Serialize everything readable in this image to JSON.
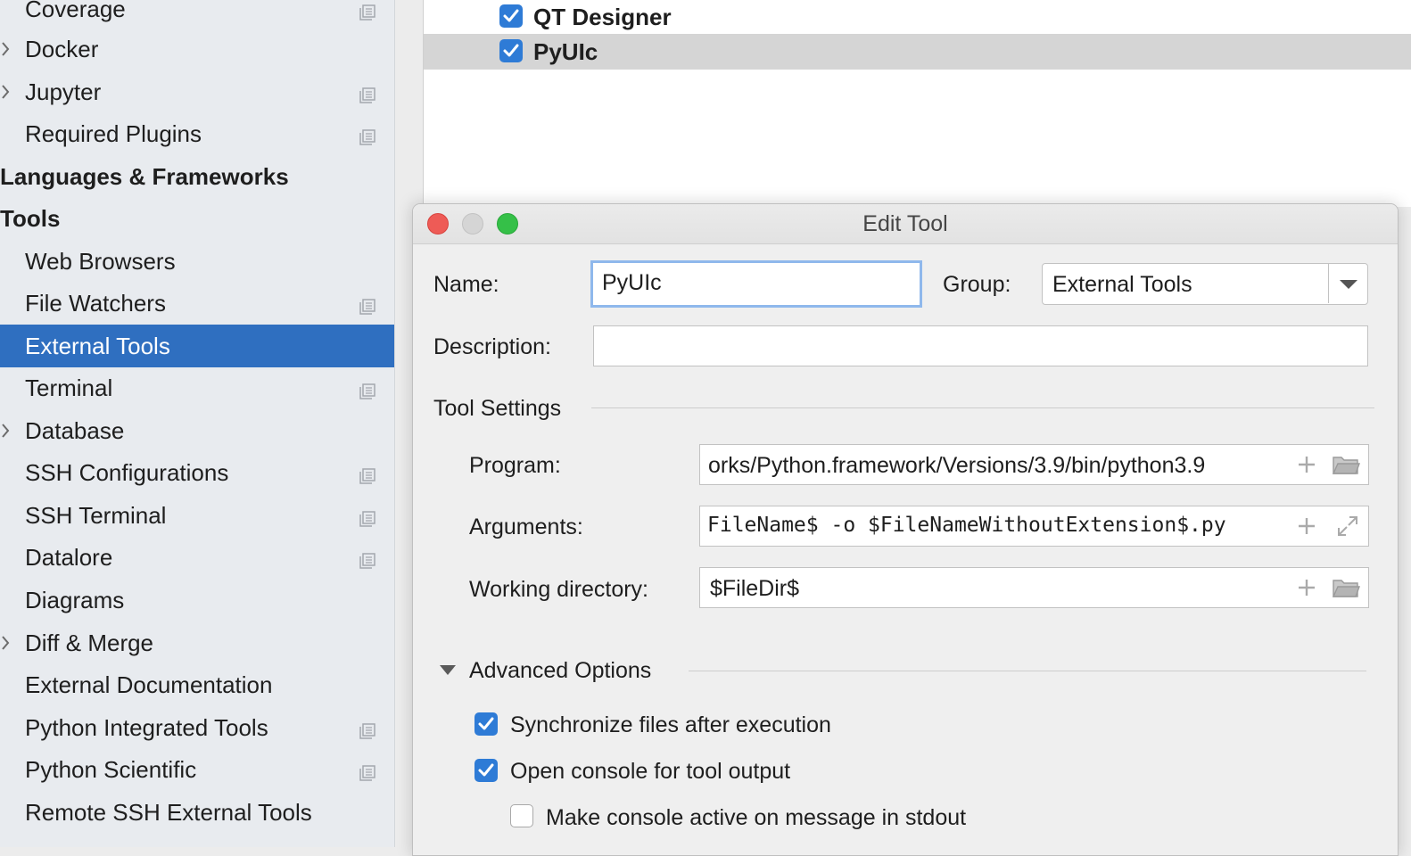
{
  "sidebar": {
    "items": [
      {
        "label": "Coverage",
        "type": "item",
        "arrow": false,
        "proj": true
      },
      {
        "label": "Docker",
        "type": "item",
        "arrow": true,
        "proj": false
      },
      {
        "label": "Jupyter",
        "type": "item",
        "arrow": true,
        "proj": true
      },
      {
        "label": "Required Plugins",
        "type": "item",
        "arrow": false,
        "proj": true
      },
      {
        "label": "Languages & Frameworks",
        "type": "header",
        "arrow": false,
        "proj": false
      },
      {
        "label": "Tools",
        "type": "header",
        "arrow": false,
        "proj": false
      },
      {
        "label": "Web Browsers",
        "type": "item",
        "arrow": false,
        "proj": false
      },
      {
        "label": "File Watchers",
        "type": "item",
        "arrow": false,
        "proj": true
      },
      {
        "label": "External Tools",
        "type": "item",
        "arrow": false,
        "proj": false,
        "selected": true
      },
      {
        "label": "Terminal",
        "type": "item",
        "arrow": false,
        "proj": true
      },
      {
        "label": "Database",
        "type": "item",
        "arrow": true,
        "proj": false
      },
      {
        "label": "SSH Configurations",
        "type": "item",
        "arrow": false,
        "proj": true
      },
      {
        "label": "SSH Terminal",
        "type": "item",
        "arrow": false,
        "proj": true
      },
      {
        "label": "Datalore",
        "type": "item",
        "arrow": false,
        "proj": true
      },
      {
        "label": "Diagrams",
        "type": "item",
        "arrow": false,
        "proj": false
      },
      {
        "label": "Diff & Merge",
        "type": "item",
        "arrow": true,
        "proj": false
      },
      {
        "label": "External Documentation",
        "type": "item",
        "arrow": false,
        "proj": false
      },
      {
        "label": "Python Integrated Tools",
        "type": "item",
        "arrow": false,
        "proj": true
      },
      {
        "label": "Python Scientific",
        "type": "item",
        "arrow": false,
        "proj": true
      },
      {
        "label": "Remote SSH External Tools",
        "type": "item",
        "arrow": false,
        "proj": false
      }
    ]
  },
  "tools_list": {
    "rows": [
      {
        "label": "QT Designer",
        "checked": true,
        "selected": false
      },
      {
        "label": "PyUIc",
        "checked": true,
        "selected": true
      }
    ]
  },
  "dialog": {
    "title": "Edit Tool",
    "name_label": "Name:",
    "name_value": "PyUIc",
    "group_label": "Group:",
    "group_value": "External Tools",
    "description_label": "Description:",
    "description_value": "",
    "tool_settings_label": "Tool Settings",
    "program_label": "Program:",
    "program_value": "orks/Python.framework/Versions/3.9/bin/python3.9",
    "arguments_label": "Arguments:",
    "arguments_value": "FileName$ -o $FileNameWithoutExtension$.py",
    "working_dir_label": "Working directory:",
    "working_dir_value": "$FileDir$",
    "advanced_label": "Advanced Options",
    "sync_label": "Synchronize files after execution",
    "sync_checked": true,
    "console_label": "Open console for tool output",
    "console_checked": true,
    "stdout_label": "Make console active on message in stdout",
    "stdout_checked": false
  },
  "icons": {
    "chevron": "chevron-right-icon",
    "project": "project-scope-icon",
    "add": "plus-icon",
    "folder": "folder-icon",
    "expand": "expand-icon",
    "dropdown": "chevron-down-icon",
    "disclosure": "triangle-down-icon"
  },
  "colors": {
    "selection": "#2f6fc0",
    "checkbox": "#2e7bd6",
    "close": "#ee5b56",
    "zoom": "#35c048"
  }
}
